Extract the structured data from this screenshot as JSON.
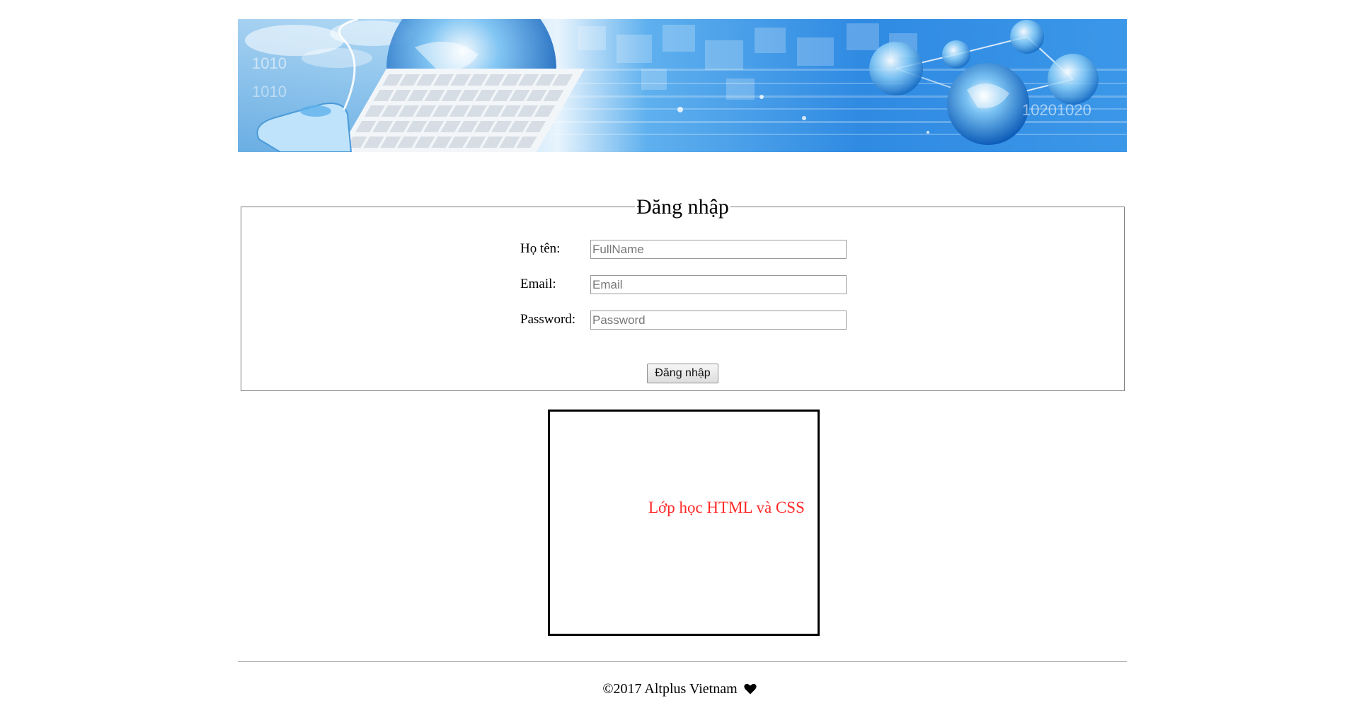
{
  "banner": {
    "binary_text": "10201020",
    "left_binary": "1010"
  },
  "login": {
    "legend": "Đăng nhập",
    "fields": [
      {
        "label": "Họ tên:",
        "placeholder": "FullName",
        "value": ""
      },
      {
        "label": "Email:",
        "placeholder": "Email",
        "value": ""
      },
      {
        "label": "Password:",
        "placeholder": "Password",
        "value": ""
      }
    ],
    "submit_label": "Đăng nhập"
  },
  "class_box": {
    "text": "Lớp học HTML và CSS",
    "text_color": "#ff2a2a"
  },
  "footer": {
    "copyright": "©2017 Altplus Vietnam",
    "heart_icon": "heart-icon"
  }
}
